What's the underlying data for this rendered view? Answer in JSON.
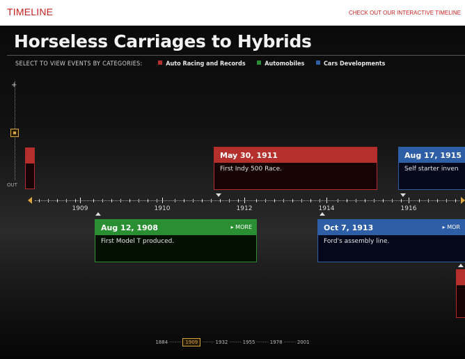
{
  "header": {
    "title": "TIMELINE",
    "link_text": "CHECK OUT OUR INTERACTIVE TIMELINE"
  },
  "main": {
    "headline": "Horseless Carriages to Hybrids",
    "category_prompt": "SELECT TO VIEW EVENTS BY CATEGORIES:",
    "categories": [
      {
        "label": "Auto Racing and Records",
        "color": "#b3302c"
      },
      {
        "label": "Automobiles",
        "color": "#2a8f32"
      },
      {
        "label": "Cars Developments",
        "color": "#2d5ea6"
      }
    ]
  },
  "zoom": {
    "in_label": "+",
    "out_label": "OUT"
  },
  "events": [
    {
      "date": "May 30, 1911",
      "text": "First Indy 500 Race.",
      "category": "red",
      "more": ""
    },
    {
      "date": "Aug 17, 1915",
      "text": "Self starter inven",
      "category": "blue",
      "more": ""
    },
    {
      "date": "Aug 12, 1908",
      "text": "First Model T produced.",
      "category": "green",
      "more": "▸ MORE"
    },
    {
      "date": "Oct 7, 1913",
      "text": "Ford's assembly line.",
      "category": "blue",
      "more": "▸ MOR"
    }
  ],
  "axis": {
    "years": [
      "1909",
      "1910",
      "1912",
      "1914",
      "1916"
    ]
  },
  "decades": {
    "items": [
      "1884",
      "1909",
      "1932",
      "1955",
      "1978",
      "2001"
    ],
    "selected": "1909"
  },
  "colors": {
    "red": "#b3302c",
    "green": "#2a8f32",
    "blue": "#2d5ea6",
    "gold": "#d9a641"
  }
}
